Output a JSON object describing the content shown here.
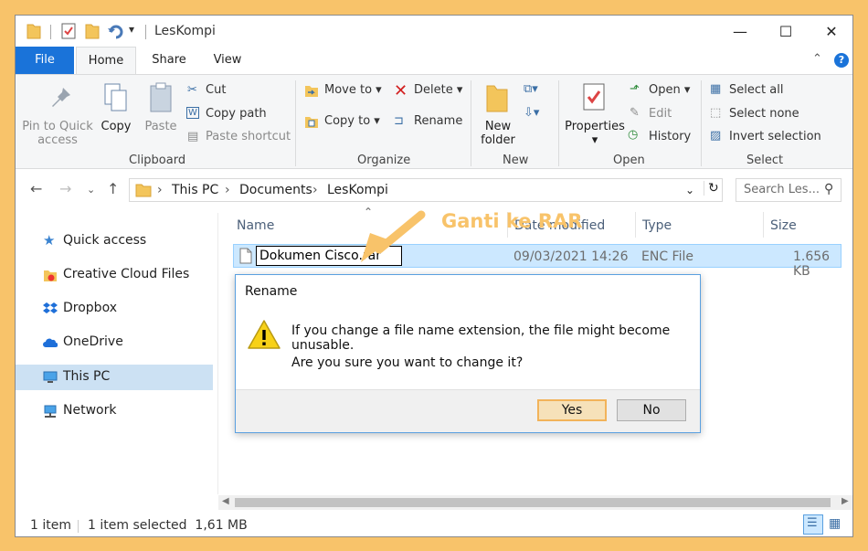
{
  "window": {
    "title": "LesKompi",
    "controls": {
      "minimize": "—",
      "maximize": "☐",
      "close": "✕"
    }
  },
  "ribbon_tabs": {
    "file": "File",
    "home": "Home",
    "share": "Share",
    "view": "View"
  },
  "ribbon": {
    "clipboard": {
      "pin_to_quick_access": "Pin to Quick\naccess",
      "copy": "Copy",
      "paste": "Paste",
      "cut": "Cut",
      "copy_path": "Copy path",
      "paste_shortcut": "Paste shortcut",
      "label": "Clipboard"
    },
    "organize": {
      "move_to": "Move to",
      "copy_to": "Copy to",
      "delete": "Delete",
      "rename": "Rename",
      "label": "Organize"
    },
    "new": {
      "new_folder": "New\nfolder",
      "label": "New"
    },
    "open": {
      "properties": "Properties",
      "open": "Open",
      "edit": "Edit",
      "history": "History",
      "label": "Open"
    },
    "select": {
      "select_all": "Select all",
      "select_none": "Select none",
      "invert_selection": "Invert selection",
      "label": "Select"
    }
  },
  "address": {
    "crumbs": [
      "This PC",
      "Documents",
      "LesKompi"
    ],
    "search_placeholder": "Search Les..."
  },
  "nav_pane": {
    "items": [
      "Quick access",
      "Creative Cloud Files",
      "Dropbox",
      "OneDrive",
      "This PC",
      "Network"
    ],
    "selected": "This PC"
  },
  "file_list": {
    "columns": {
      "name": "Name",
      "date_modified": "Date modified",
      "type": "Type",
      "size": "Size"
    },
    "rows": [
      {
        "name": "Dokumen Cisco.rar",
        "date_modified": "09/03/2021 14:26",
        "type": "ENC File",
        "size": "1.656 KB"
      }
    ]
  },
  "dialog": {
    "title": "Rename",
    "message": "If you change a file name extension, the file might become unusable.",
    "question": "Are you sure you want to change it?",
    "yes": "Yes",
    "no": "No"
  },
  "status_bar": {
    "count": "1 item",
    "selection": "1 item selected  1,61 MB"
  },
  "annotation": {
    "text": "Ganti ke RAR",
    "color": "#f8c36a"
  },
  "colors": {
    "accent": "#1a73d9",
    "selection": "#cce8ff",
    "frame": "#f8c36a"
  }
}
